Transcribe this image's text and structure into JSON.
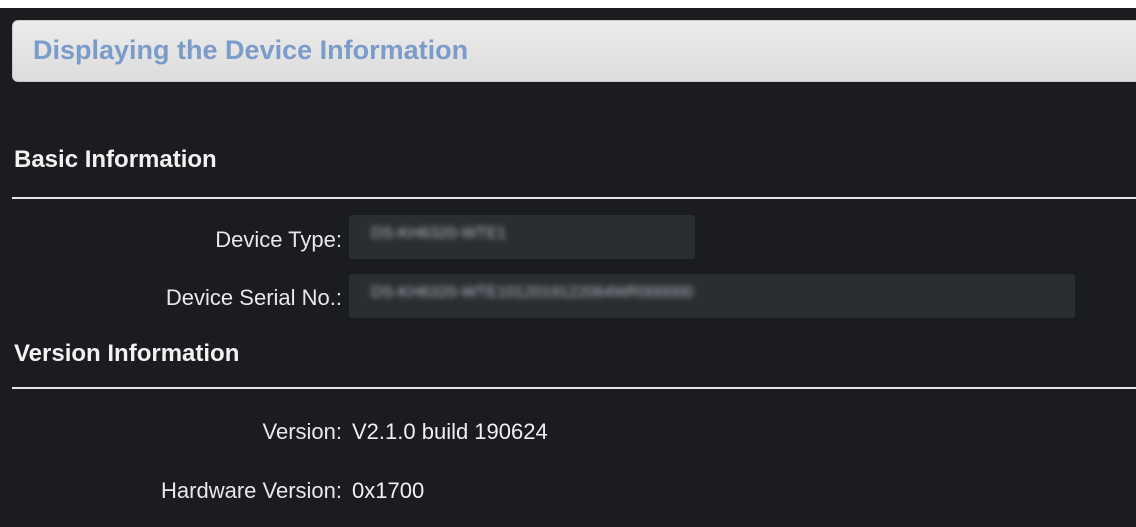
{
  "header": {
    "title": "Displaying the Device Information"
  },
  "basic_info": {
    "section_title": "Basic Information",
    "device_type_label": "Device Type:",
    "device_type_value": "DS-KH6320-WTE1",
    "serial_label": "Device Serial No.:",
    "serial_value": "DS-KH6320-WTE1012019122064WR000000"
  },
  "version_info": {
    "section_title": "Version Information",
    "version_label": "Version:",
    "version_value": "V2.1.0 build 190624",
    "hardware_label": "Hardware Version:",
    "hardware_value": "0x1700"
  },
  "colors": {
    "background": "#1a1c1f",
    "title_text": "#7b9cc9",
    "field_box": "#2a2d31"
  }
}
